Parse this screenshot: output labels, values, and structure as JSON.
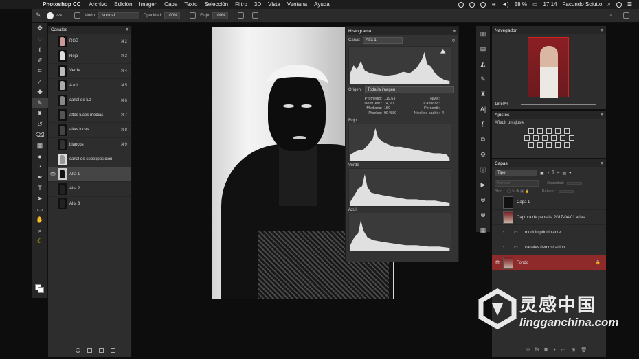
{
  "menubar": {
    "app": "Photoshop CC",
    "items": [
      "Archivo",
      "Edición",
      "Imagen",
      "Capa",
      "Texto",
      "Selección",
      "Filtro",
      "3D",
      "Vista",
      "Ventana",
      "Ayuda"
    ],
    "battery": "58 %",
    "time": "17:14",
    "user": "Facundo Sciutto"
  },
  "options": {
    "brush_size": "224",
    "mode_label": "Modo:",
    "mode_value": "Normal",
    "opacity_label": "Opacidad:",
    "opacity_value": "100%",
    "flow_label": "Flujo:",
    "flow_value": "100%"
  },
  "channels": {
    "title": "Canales",
    "rows": [
      {
        "name": "RGB",
        "shortcut": "⌘2"
      },
      {
        "name": "Rojo",
        "shortcut": "⌘3"
      },
      {
        "name": "Verde",
        "shortcut": "⌘4"
      },
      {
        "name": "Azul",
        "shortcut": "⌘5"
      },
      {
        "name": "canal de luz",
        "shortcut": "⌘6"
      },
      {
        "name": "altas luces medias",
        "shortcut": "⌘7"
      },
      {
        "name": "altas luces",
        "shortcut": "⌘8"
      },
      {
        "name": "blancos",
        "shortcut": "⌘9"
      },
      {
        "name": "canal de subexposicion",
        "shortcut": ""
      },
      {
        "name": "Alfa 1",
        "shortcut": ""
      },
      {
        "name": "Alfa 2",
        "shortcut": ""
      },
      {
        "name": "Alfa 3",
        "shortcut": ""
      }
    ]
  },
  "histogram": {
    "title": "Histograma",
    "channel_label": "Canal:",
    "channel_value": "Alfa 1",
    "origin_label": "Origen:",
    "origin_value": "Toda la imagen",
    "stats": {
      "promedio_label": "Promedio:",
      "promedio": "119,63",
      "desv_label": "Desv. est.:",
      "desv": "74,90",
      "mediana_label": "Mediana:",
      "mediana": "150",
      "pixeles_label": "Píxeles:",
      "pixeles": "994880",
      "nivel_label": "Nivel:",
      "cantidad_label": "Cantidad:",
      "percentil_label": "Percentil:",
      "cache_label": "Nivel de caché:",
      "cache": "4"
    },
    "rojo": "Rojo",
    "verde": "Verde",
    "azul": "Azul"
  },
  "navigator": {
    "title": "Navegador",
    "zoom": "18,50%"
  },
  "adjustments": {
    "title": "Ajustes",
    "subtitle": "Añadir un ajuste"
  },
  "layers": {
    "title": "Capas",
    "filter_value": "Tipo",
    "blend_value": "Normal",
    "opacity_label": "Opacidad:",
    "lock_label": "Bloq.:",
    "fill_label": "Relleno:",
    "items": [
      {
        "name": "Capa 1",
        "kind": "layer"
      },
      {
        "name": "Captura de pantalla 2017-04-01 a las 1...",
        "kind": "layer"
      },
      {
        "name": "modulo principiante",
        "kind": "folder"
      },
      {
        "name": "canales demostracion",
        "kind": "folder"
      },
      {
        "name": "Fondo",
        "kind": "layer"
      }
    ]
  },
  "watermark": {
    "cn": "灵感中国",
    "url": "lingganchina.com"
  }
}
